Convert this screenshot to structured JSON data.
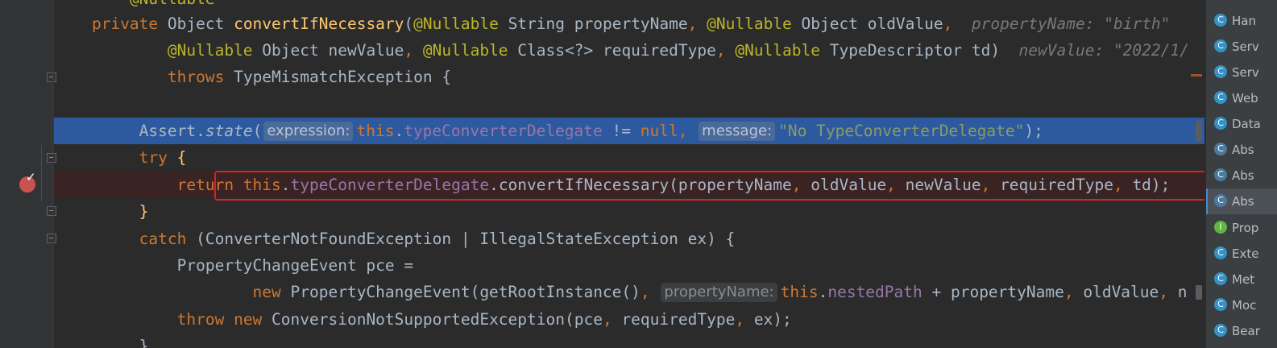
{
  "code": {
    "line0": {
      "ann": "@Nullable"
    },
    "line1": {
      "kw": "private ",
      "type": "Object ",
      "method": "convertIfNecessary",
      "open": "(",
      "ann1": "@Nullable",
      "p1": " String propertyName",
      "c1": ", ",
      "ann2": "@Nullable",
      "p2": " Object oldValue",
      "c2": ",",
      "hint": "  propertyName: \"birth\""
    },
    "line2": {
      "ann1": "@Nullable",
      "p1": " Object newValue",
      "c1": ", ",
      "ann2": "@Nullable",
      "p2": " Class<?> requiredType",
      "c2": ", ",
      "ann3": "@Nullable",
      "p3": " TypeDescriptor td)",
      "hint": "  newValue: \"2022/1/"
    },
    "line3": {
      "kw": "throws",
      "rest": " TypeMismatchException {"
    },
    "line5": {
      "cls": "Assert.",
      "method": "state",
      "open": "(",
      "hint1": "expression:",
      "this": "this",
      "dot": ".",
      "field": "typeConverterDelegate",
      "op": " != ",
      "null": "null",
      "comma": ", ",
      "hint2": "message:",
      "str": "\"No TypeConverterDelegate\"",
      "close": ");"
    },
    "line6": {
      "kw": "try",
      "brace": " {"
    },
    "line7": {
      "ret": "return ",
      "this": "this",
      "dot": ".",
      "field": "typeConverterDelegate",
      "call": ".convertIfNecessary(propertyName",
      "c1": ", ",
      "a2": "oldValue",
      "c2": ", ",
      "a3": "newValue",
      "c3": ", ",
      "a4": "requiredType",
      "c4": ", ",
      "a5": "td);"
    },
    "line8": {
      "brace": "}"
    },
    "line9": {
      "kw": "catch",
      "rest": " (ConverterNotFoundException | IllegalStateException ex) {"
    },
    "line10": {
      "text": "PropertyChangeEvent pce ="
    },
    "line11": {
      "kw": "new ",
      "call": "PropertyChangeEvent(getRootInstance()",
      "comma": ", ",
      "hint": "propertyName:",
      "this": "this",
      "dot": ".",
      "field": "nestedPath",
      "rest": " + propertyName",
      "c2": ", ",
      "a3": "oldValue",
      "c3": ", ",
      "tail": "n"
    },
    "line12": {
      "kw1": "throw ",
      "kw2": "new ",
      "call": "ConversionNotSupportedException(pce",
      "c1": ", ",
      "a2": "requiredType",
      "c2": ", ",
      "a3": "ex);"
    },
    "line13": {
      "brace": "}"
    }
  },
  "structure_panel": {
    "items": [
      {
        "icon": "C",
        "label": "Han"
      },
      {
        "icon": "C",
        "label": "Serv"
      },
      {
        "icon": "C",
        "label": "Serv"
      },
      {
        "icon": "C",
        "label": "Web"
      },
      {
        "icon": "C",
        "label": "Data"
      },
      {
        "icon": "C",
        "label": "Abs"
      },
      {
        "icon": "C",
        "label": "Abs"
      },
      {
        "icon": "C",
        "label": "Abs"
      },
      {
        "icon": "I",
        "label": "Prop"
      },
      {
        "icon": "C",
        "label": "Exte"
      },
      {
        "icon": "C",
        "label": "Met"
      },
      {
        "icon": "C",
        "label": "Moc"
      },
      {
        "icon": "C",
        "label": "Bear"
      }
    ]
  },
  "colors": {
    "background": "#2b2b2b",
    "execution_line": "#2d5a9e",
    "breakpoint": "#c75450",
    "highlight_box": "#e01e1e",
    "keyword": "#cc7832",
    "annotation": "#bbb529",
    "field": "#9876aa",
    "method": "#ffc66d",
    "string": "#6a8759"
  }
}
